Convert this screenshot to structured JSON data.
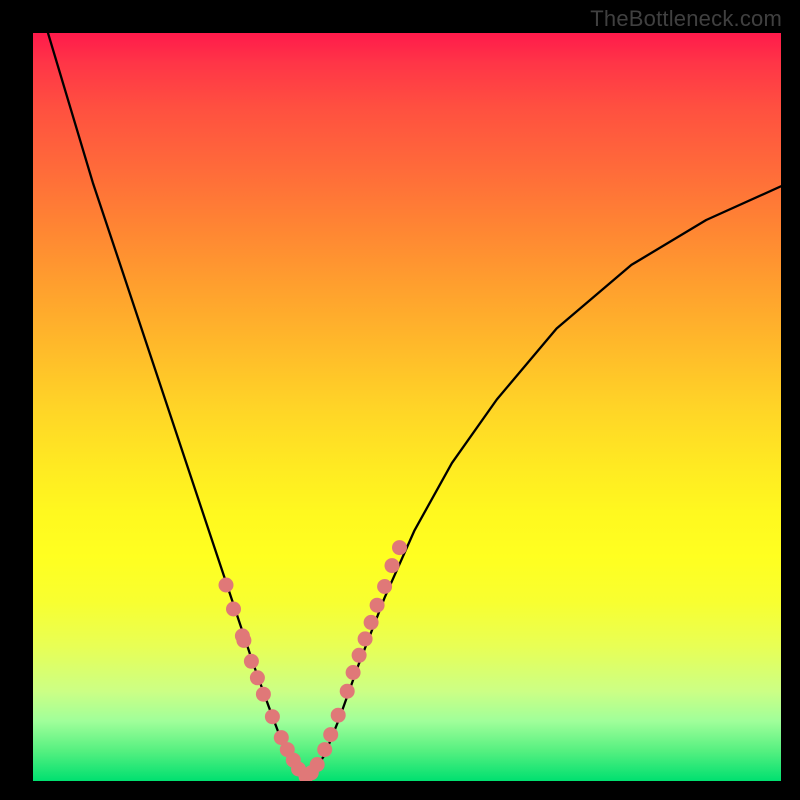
{
  "watermark": "TheBottleneck.com",
  "chart_data": {
    "type": "line",
    "title": "",
    "xlabel": "",
    "ylabel": "",
    "xlim": [
      0,
      1
    ],
    "ylim": [
      0,
      1
    ],
    "curve": {
      "name": "bottleneck-curve",
      "x": [
        0.02,
        0.05,
        0.08,
        0.12,
        0.16,
        0.2,
        0.24,
        0.27,
        0.295,
        0.315,
        0.33,
        0.345,
        0.355,
        0.365,
        0.375,
        0.39,
        0.41,
        0.435,
        0.47,
        0.51,
        0.56,
        0.62,
        0.7,
        0.8,
        0.9,
        1.0
      ],
      "y": [
        1.0,
        0.9,
        0.8,
        0.68,
        0.56,
        0.44,
        0.32,
        0.23,
        0.155,
        0.1,
        0.06,
        0.03,
        0.012,
        0.003,
        0.012,
        0.035,
        0.085,
        0.155,
        0.245,
        0.335,
        0.425,
        0.51,
        0.605,
        0.69,
        0.75,
        0.795
      ]
    },
    "highlight_points": {
      "name": "highlight-dots",
      "color": "#e07878",
      "x": [
        0.258,
        0.268,
        0.28,
        0.282,
        0.292,
        0.3,
        0.308,
        0.32,
        0.332,
        0.34,
        0.348,
        0.355,
        0.365,
        0.372,
        0.38,
        0.39,
        0.398,
        0.408,
        0.42,
        0.428,
        0.436,
        0.444,
        0.452,
        0.46,
        0.47,
        0.48,
        0.49
      ],
      "y": [
        0.262,
        0.23,
        0.194,
        0.188,
        0.16,
        0.138,
        0.116,
        0.086,
        0.058,
        0.042,
        0.028,
        0.016,
        0.006,
        0.011,
        0.022,
        0.042,
        0.062,
        0.088,
        0.12,
        0.145,
        0.168,
        0.19,
        0.212,
        0.235,
        0.26,
        0.288,
        0.312
      ]
    },
    "gradient_stops": [
      {
        "pos": 0.0,
        "color": "#ff1a4b"
      },
      {
        "pos": 0.5,
        "color": "#ffd427"
      },
      {
        "pos": 0.7,
        "color": "#ffff20"
      },
      {
        "pos": 1.0,
        "color": "#00e070"
      }
    ]
  }
}
